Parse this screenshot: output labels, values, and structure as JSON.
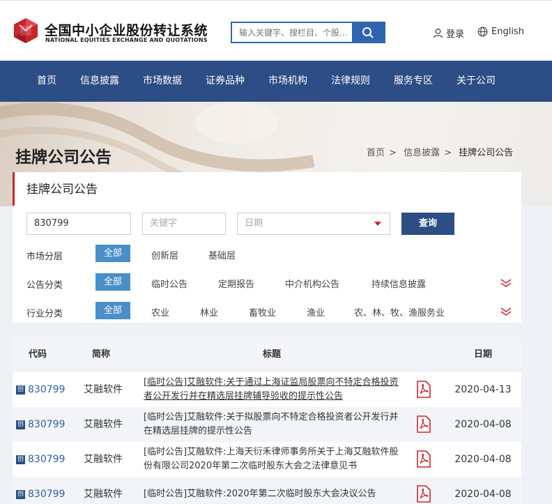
{
  "header": {
    "logo_cn": "全国中小企业股份转让系统",
    "logo_en": "NATIONAL EQUITIES EXCHANGE AND QUOTATIONS",
    "search_placeholder": "输入关键字、搜栏目、个股...",
    "login_label": "登录",
    "lang_label": "English"
  },
  "nav": [
    "首页",
    "信息披露",
    "市场数据",
    "证券品种",
    "市场机构",
    "法律规则",
    "服务专区",
    "关于公司"
  ],
  "banner": {
    "title": "挂牌公司公告",
    "breadcrumb": [
      "首页",
      "信息披露",
      "挂牌公司公告"
    ]
  },
  "filter": {
    "title": "挂牌公司公告",
    "code_value": "830799",
    "keyword_placeholder": "关键字",
    "date_placeholder": "日期",
    "query_label": "查询",
    "rows": [
      {
        "label": "市场分层",
        "active": "全部",
        "options": [
          "创新层",
          "基础层"
        ]
      },
      {
        "label": "公告分类",
        "active": "全部",
        "options": [
          "临时公告",
          "定期报告",
          "中介机构公告",
          "持续信息披露"
        ]
      },
      {
        "label": "行业分类",
        "active": "全部",
        "options": [
          "农业",
          "林业",
          "畜牧业",
          "渔业",
          "农、林、牧、渔服务业"
        ]
      }
    ]
  },
  "table": {
    "headers": [
      "代码",
      "简称",
      "标题",
      "日期"
    ],
    "badge": "创",
    "rows": [
      {
        "code": "830799",
        "abbr": "艾融软件",
        "title": "[临时公告]艾融软件:关于通过上海证监局股票向不特定合格投资者公开发行并在精选层挂牌辅导验收的提示性公告",
        "date": "2020-04-13"
      },
      {
        "code": "830799",
        "abbr": "艾融软件",
        "title": "[临时公告]艾融软件:关于拟股票向不特定合格投资者公开发行并在精选层挂牌的提示性公告",
        "date": "2020-04-08"
      },
      {
        "code": "830799",
        "abbr": "艾融软件",
        "title": "[临时公告]艾融软件:上海天衍禾律师事务所关于上海艾融软件股份有限公司2020年第二次临时股东大会之法律意见书",
        "date": "2020-04-08"
      },
      {
        "code": "830799",
        "abbr": "艾融软件",
        "title": "[临时公告]艾融软件:2020年第二次临时股东大会决议公告",
        "date": "2020-04-08"
      }
    ]
  },
  "colors": {
    "nav_bg": "#2c4d85",
    "accent_red": "#c7252c",
    "chip_blue": "#4a8fc8",
    "link_blue": "#2d5fa3"
  }
}
